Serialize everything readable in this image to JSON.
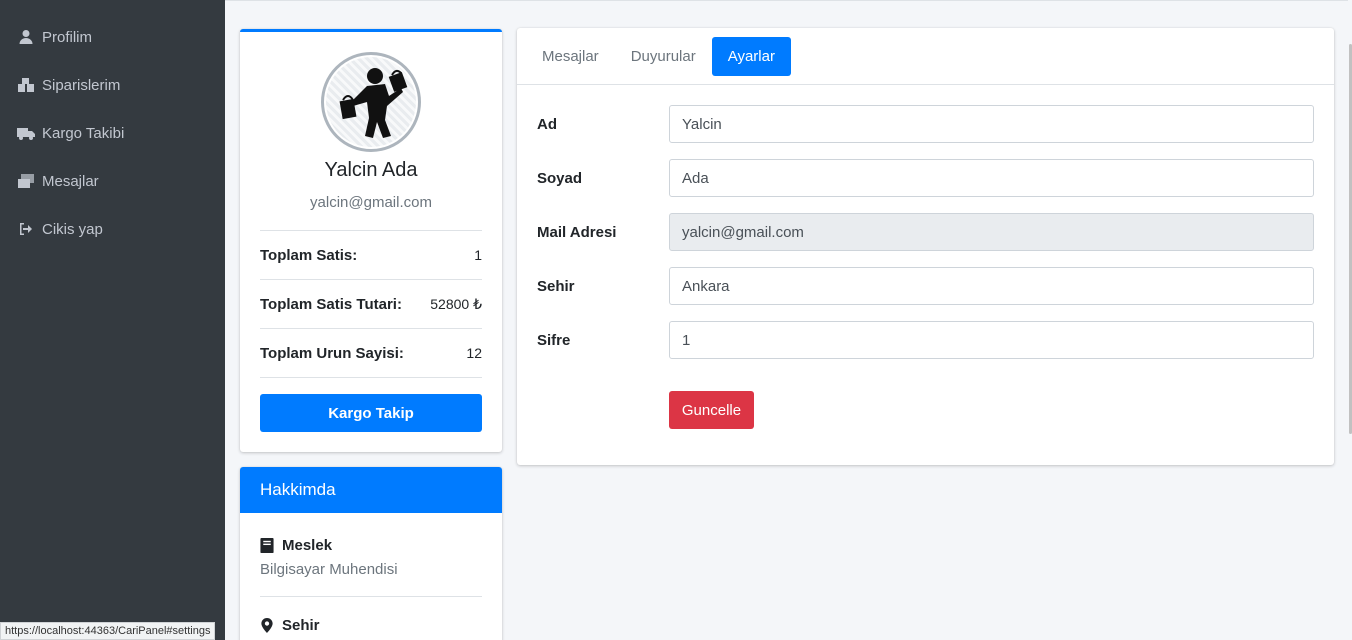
{
  "sidebar": {
    "items": [
      {
        "label": "Profilim",
        "icon": "user-icon"
      },
      {
        "label": "Siparislerim",
        "icon": "boxes-icon"
      },
      {
        "label": "Kargo Takibi",
        "icon": "truck-icon"
      },
      {
        "label": "Mesajlar",
        "icon": "mail-bulk-icon"
      },
      {
        "label": "Cikis yap",
        "icon": "sign-out-icon"
      }
    ]
  },
  "profile": {
    "name": "Yalcin Ada",
    "email": "yalcin@gmail.com",
    "stats": [
      {
        "label": "Toplam Satis:",
        "value": "1"
      },
      {
        "label": "Toplam Satis Tutari:",
        "value": "52800 ₺"
      },
      {
        "label": "Toplam Urun Sayisi:",
        "value": "12"
      }
    ],
    "button_label": "Kargo Takip"
  },
  "about": {
    "title": "Hakkimda",
    "job_title": "Meslek",
    "job_value": "Bilgisayar Muhendisi",
    "city_title": "Sehir"
  },
  "tabs": [
    {
      "label": "Mesajlar",
      "active": false
    },
    {
      "label": "Duyurular",
      "active": false
    },
    {
      "label": "Ayarlar",
      "active": true
    }
  ],
  "form": {
    "fields": [
      {
        "label": "Ad",
        "value": "Yalcin",
        "readonly": false
      },
      {
        "label": "Soyad",
        "value": "Ada",
        "readonly": false
      },
      {
        "label": "Mail Adresi",
        "value": "yalcin@gmail.com",
        "readonly": true
      },
      {
        "label": "Sehir",
        "value": "Ankara",
        "readonly": false
      },
      {
        "label": "Sifre",
        "value": "1",
        "readonly": false
      }
    ],
    "submit_label": "Guncelle"
  },
  "status_url": "https://localhost:44363/CariPanel#settings",
  "colors": {
    "sidebar_bg": "#343a40",
    "primary": "#007bff",
    "danger": "#dc3545"
  }
}
